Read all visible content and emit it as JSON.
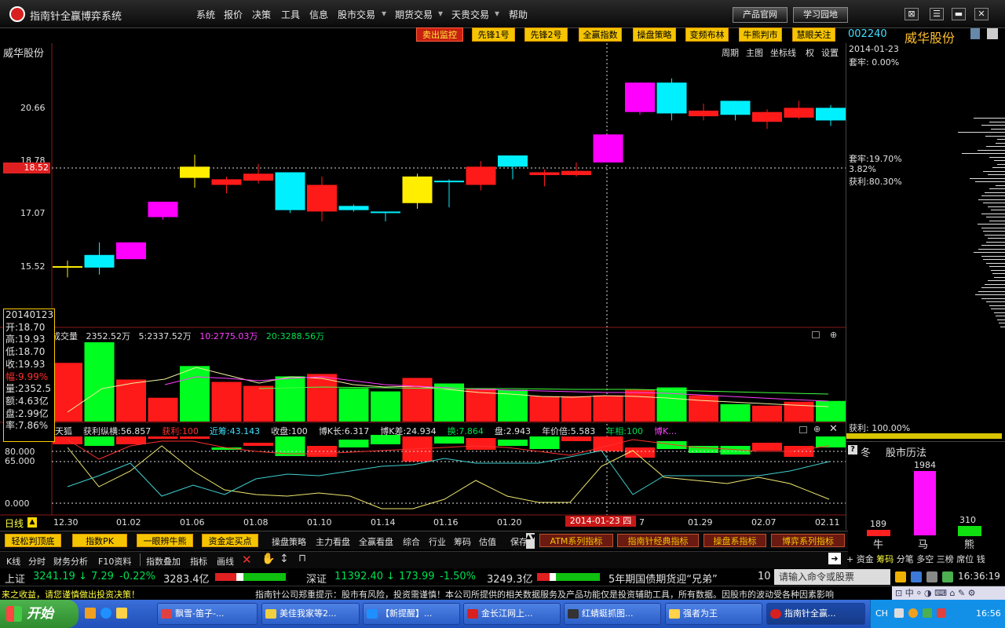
{
  "app": {
    "title": "指南针全赢博弈系统"
  },
  "menu": [
    "系统",
    "报价",
    "决策",
    "工具",
    "信息",
    "股市交易",
    "期货交易",
    "天贵交易",
    "帮助"
  ],
  "top_buttons": {
    "product": "产品官网",
    "learn": "学习园地"
  },
  "toolbar_tags": [
    "卖出监控",
    "先锋1号",
    "先锋2号",
    "全赢指数",
    "操盘策略",
    "变频布林",
    "牛熊判市",
    "慧眼关注"
  ],
  "stock": {
    "code": "002240",
    "name": "威华股份",
    "date": "2014-01-23",
    "taolao_label": "套牢:",
    "taolao_value": "0.00%"
  },
  "chart": {
    "title": "威华股份",
    "options": [
      "周期",
      "主图",
      "坐标线",
      "权",
      "设置"
    ],
    "price_ticks": [
      "20.66",
      "18.78",
      "17.07",
      "15.52"
    ],
    "current_price": "18.52",
    "dash_label": "2014-01-23 四",
    "volume_header": {
      "name": "成交量",
      "vol": "2352.52万",
      "ma5": "5:2337.52万",
      "ma10": "10:2775.03万",
      "ma20": "20:3288.56万"
    },
    "indicator_header": {
      "name": "天狐",
      "a": "获利纵横:56.857",
      "b": "获利:100",
      "c": "近筹:43.143",
      "d": "收盘:100",
      "e": "博K长:6.317",
      "f": "博K差:24.934",
      "g": "换:7.864",
      "h": "盘:2.943",
      "i": "年价倍:5.583",
      "j": "年相:100",
      "k": "博K…"
    },
    "indicator_ticks": [
      "80.000",
      "65.000",
      "0.000"
    ],
    "date_labels": [
      "12.30",
      "01.02",
      "01.06",
      "01.08",
      "01.10",
      "01.14",
      "01.16",
      "01.20",
      "01.27",
      "01.29",
      "02.07",
      "02.11"
    ],
    "period_label": "日线"
  },
  "chart_data": {
    "type": "candlestick",
    "candles": [
      {
        "o": 15.0,
        "h": 15.2,
        "l": 14.6,
        "c": 15.0,
        "col": "yellow"
      },
      {
        "o": 14.95,
        "h": 15.85,
        "l": 14.7,
        "c": 15.4,
        "col": "cyan"
      },
      {
        "o": 15.25,
        "h": 15.85,
        "l": 15.25,
        "c": 15.85,
        "col": "magenta"
      },
      {
        "o": 16.75,
        "h": 17.3,
        "l": 16.65,
        "c": 17.3,
        "col": "magenta"
      },
      {
        "o": 18.15,
        "h": 18.98,
        "l": 17.8,
        "c": 18.55,
        "col": "yellow"
      },
      {
        "o": 17.9,
        "h": 18.2,
        "l": 17.6,
        "c": 18.1,
        "col": "red"
      },
      {
        "o": 18.05,
        "h": 18.65,
        "l": 17.95,
        "c": 18.3,
        "col": "red"
      },
      {
        "o": 17.0,
        "h": 18.3,
        "l": 16.9,
        "c": 18.35,
        "col": "cyan"
      },
      {
        "o": 16.95,
        "h": 18.2,
        "l": 16.6,
        "c": 17.9,
        "col": "red"
      },
      {
        "o": 17.0,
        "h": 17.2,
        "l": 16.95,
        "c": 17.15,
        "col": "cyan"
      },
      {
        "o": 16.95,
        "h": 16.95,
        "l": 16.6,
        "c": 16.9,
        "col": "cyan"
      },
      {
        "o": 17.25,
        "h": 18.3,
        "l": 17.05,
        "c": 18.2,
        "col": "yellow"
      },
      {
        "o": 18.05,
        "h": 18.1,
        "l": 17.1,
        "c": 18.05,
        "col": "cyan"
      },
      {
        "o": 17.9,
        "h": 18.75,
        "l": 17.7,
        "c": 18.55,
        "col": "red"
      },
      {
        "o": 18.55,
        "h": 18.8,
        "l": 18.1,
        "c": 18.95,
        "col": "cyan"
      },
      {
        "o": 18.25,
        "h": 18.45,
        "l": 17.85,
        "c": 18.35,
        "col": "red"
      },
      {
        "o": 18.25,
        "h": 18.7,
        "l": 18.2,
        "c": 18.4,
        "col": "red"
      },
      {
        "o": 18.7,
        "h": 19.7,
        "l": 18.7,
        "c": 19.7,
        "col": "magenta"
      },
      {
        "o": 20.5,
        "h": 21.55,
        "l": 20.4,
        "c": 21.55,
        "col": "magenta"
      },
      {
        "o": 21.55,
        "h": 21.7,
        "l": 20.2,
        "c": 20.45,
        "col": "cyan"
      },
      {
        "o": 20.35,
        "h": 20.8,
        "l": 20.2,
        "c": 20.55,
        "col": "red"
      },
      {
        "o": 20.9,
        "h": 20.9,
        "l": 20.2,
        "c": 20.4,
        "col": "cyan"
      },
      {
        "o": 20.15,
        "h": 20.6,
        "l": 19.9,
        "c": 20.5,
        "col": "red"
      },
      {
        "o": 20.3,
        "h": 20.9,
        "l": 20.25,
        "c": 20.65,
        "col": "red"
      },
      {
        "o": 20.65,
        "h": 20.75,
        "l": 20.0,
        "c": 20.2,
        "col": "cyan"
      }
    ],
    "volume": [
      {
        "v": 0.74,
        "col": "red"
      },
      {
        "v": 1.0,
        "col": "green"
      },
      {
        "v": 0.53,
        "col": "red"
      },
      {
        "v": 0.3,
        "col": "red"
      },
      {
        "v": 0.7,
        "col": "green"
      },
      {
        "v": 0.5,
        "col": "red"
      },
      {
        "v": 0.45,
        "col": "red"
      },
      {
        "v": 0.57,
        "col": "green"
      },
      {
        "v": 0.6,
        "col": "red"
      },
      {
        "v": 0.42,
        "col": "green"
      },
      {
        "v": 0.38,
        "col": "green"
      },
      {
        "v": 0.55,
        "col": "red"
      },
      {
        "v": 0.48,
        "col": "green"
      },
      {
        "v": 0.42,
        "col": "red"
      },
      {
        "v": 0.4,
        "col": "green"
      },
      {
        "v": 0.32,
        "col": "red"
      },
      {
        "v": 0.32,
        "col": "red"
      },
      {
        "v": 0.33,
        "col": "red"
      },
      {
        "v": 0.4,
        "col": "red"
      },
      {
        "v": 0.43,
        "col": "green"
      },
      {
        "v": 0.33,
        "col": "red"
      },
      {
        "v": 0.22,
        "col": "green"
      },
      {
        "v": 0.2,
        "col": "red"
      },
      {
        "v": 0.25,
        "col": "red"
      },
      {
        "v": 0.26,
        "col": "green"
      }
    ]
  },
  "tooltip": [
    "20140123",
    "开:18.70",
    "高:19.93",
    "低:18.70",
    "收:19.93",
    "幅:9.99%",
    "量:2352.5",
    "额:4.63亿",
    "盘:2.99亿",
    "率:7.86%"
  ],
  "right_panel": {
    "taolao2": "套牢:19.70%",
    "pct2": "3.82%",
    "huoli": "获利:80.30%",
    "huoli100": "获利: 100.00%",
    "win_label": "冬",
    "history_title": "股市历法",
    "bars": [
      {
        "label": "牛",
        "value": "189"
      },
      {
        "label": "马",
        "value": "1984"
      },
      {
        "label": "熊",
        "value": "310"
      }
    ]
  },
  "bottom_row1": [
    "轻松判顶底",
    "指数PK",
    "一眼辨牛熊",
    "资金定买点"
  ],
  "bottom_row1_text": [
    "操盘策略",
    "主力看盘",
    "全赢看盘",
    "综合",
    "行业",
    "筹码",
    "估值",
    "保存"
  ],
  "bottom_row1_pills": [
    "ATM系列指标",
    "指南针经典指标",
    "操盘系指标",
    "博弈系列指标"
  ],
  "bottom_row2": [
    "K线",
    "分时",
    "财务分析",
    "F10资料",
    "指数叠加",
    "指标",
    "画线"
  ],
  "bottom_row2_right": [
    "资金",
    "筹码",
    "分笔",
    "多空",
    "三榜",
    "席位",
    "钱"
  ],
  "ticker": {
    "sh_label": "上证",
    "sh_val": "3241.19",
    "sh_arrow": "↓",
    "sh_chg": "7.29",
    "sh_pct": "-0.22%",
    "sh_amt": "3283.4亿",
    "sz_label": "深证",
    "sz_val": "11392.40",
    "sz_arrow": "↓",
    "sz_chg": "173.99",
    "sz_pct": "-1.50%",
    "sz_amt": "3249.3亿",
    "news": "5年期国债期货迎“兄弟”",
    "news_tail": "10",
    "cmd_placeholder": "请输入命令或股票",
    "time": "16:36:19"
  },
  "ticker2": {
    "left": "来之收益，请您谨慎做出投资决策！",
    "right": "指南针公司郑重提示：股市有风险，投资需谨慎！本公司所提供的相关数据服务及产品功能仅是投资辅助工具，所有数据。因股市的波动受各种因素影响"
  },
  "taskbar": {
    "start": "开始",
    "tasks": [
      "飘雪-笛子-...",
      "美佳我家等2...",
      "【新提醒】...",
      "金长江网上...",
      "红蜻蜓抓图...",
      "强者为王",
      "指南针全赢..."
    ],
    "tray": "CH",
    "clock": "16:56"
  }
}
